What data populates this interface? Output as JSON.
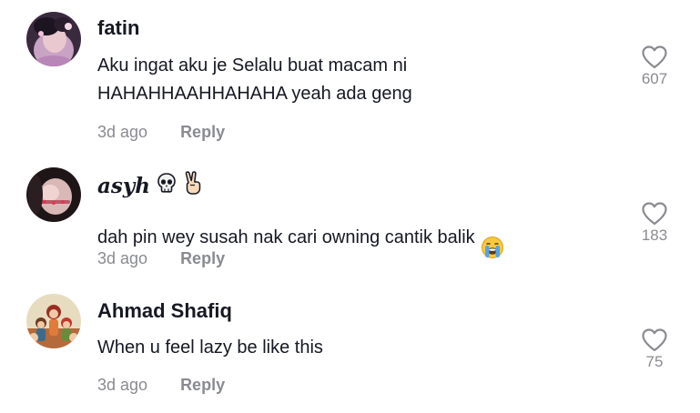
{
  "comments": [
    {
      "username": "fatin",
      "text": "Aku ingat aku je Selalu buat macam ni\nHAHAHHAAHHAHAHA yeah ada geng",
      "time": "3d ago",
      "reply_label": "Reply",
      "likes": "607",
      "avatar_icon": "avatar-photo-pink",
      "heart_icon": "heart-outline-icon"
    },
    {
      "username": "asyh",
      "username_emojis": [
        "skull-emoji",
        "victory-hand-emoji"
      ],
      "text": "dah pin wey susah nak cari owning cantik balik",
      "text_emoji": "loudly-crying-face-emoji",
      "time": "3d ago",
      "reply_label": "Reply",
      "likes": "183",
      "avatar_icon": "avatar-photo-dark",
      "heart_icon": "heart-outline-icon"
    },
    {
      "username": "Ahmad Shafiq",
      "text": "When u feel lazy be like this",
      "time": "3d ago",
      "reply_label": "Reply",
      "likes": "75",
      "avatar_icon": "avatar-cartoon-group",
      "heart_icon": "heart-outline-icon"
    }
  ],
  "colors": {
    "primary_text": "#161823",
    "secondary_text": "#8a8b91",
    "background": "#ffffff"
  }
}
